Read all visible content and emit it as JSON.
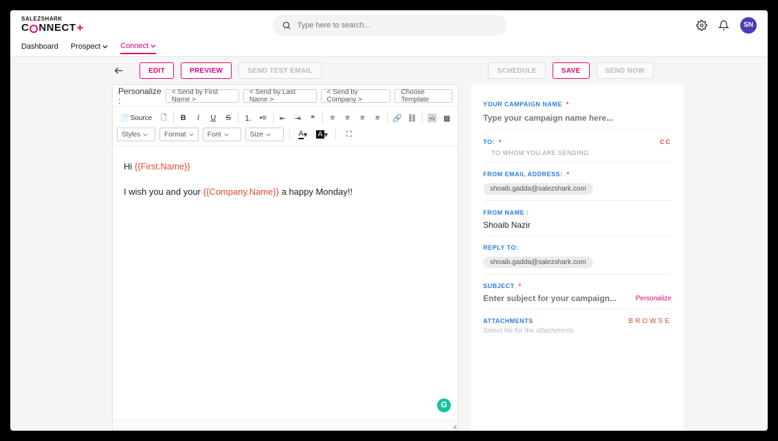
{
  "logo": {
    "top": "SALEZSHARK",
    "bot_prefix": "C",
    "bot_suffix": "NNECT",
    "plus": "+"
  },
  "search": {
    "placeholder": "Type here to search..."
  },
  "avatar": "SN",
  "nav": {
    "dashboard": "Dashboard",
    "prospect": "Prospect",
    "connect": "Connect"
  },
  "toolbar": {
    "edit": "EDIT",
    "preview": "PREVIEW",
    "send_test": "SEND TEST EMAIL",
    "schedule": "SCHEDULE",
    "save": "SAVE",
    "send_now": "SEND NOW"
  },
  "personalize": {
    "label": "Personalize :",
    "first_name": "< Send by First Name >",
    "last_name": "< Send by Last Name >",
    "company": "< Send by Company >",
    "choose_template": "Choose Template"
  },
  "rte": {
    "source": "Source",
    "styles": "Styles",
    "format": "Format",
    "font": "Font",
    "size": "Size"
  },
  "editor": {
    "greeting_prefix": "Hi ",
    "greeting_var": "{{First.Name}}",
    "body_prefix": "I wish you and your ",
    "body_var": "{{Company.Name}}",
    "body_suffix": " a happy Monday!!"
  },
  "form": {
    "campaign_label": "YOUR CAMPAIGN NAME",
    "campaign_placeholder": "Type your campaign name here...",
    "to_label": "TO:",
    "cc": "CC",
    "to_text": "TO WHOM YOU ARE SENDING",
    "from_email_label": "FROM EMAIL ADDRESS:",
    "from_email_value": "shoaib.gadda@salezshark.com",
    "from_name_label": "FROM NAME :",
    "from_name_value": "Shoaib Nazir",
    "reply_to_label": "REPLY TO:",
    "reply_to_value": "shoaib.gadda@salezshark.com",
    "subject_label": "SUBJECT",
    "subject_placeholder": "Enter subject for your campaign...",
    "personalize_link": "Personalize",
    "attachments_label": "ATTACHMENTS",
    "attachments_text": "Select file for the attachments",
    "browse": "BROWSE"
  }
}
